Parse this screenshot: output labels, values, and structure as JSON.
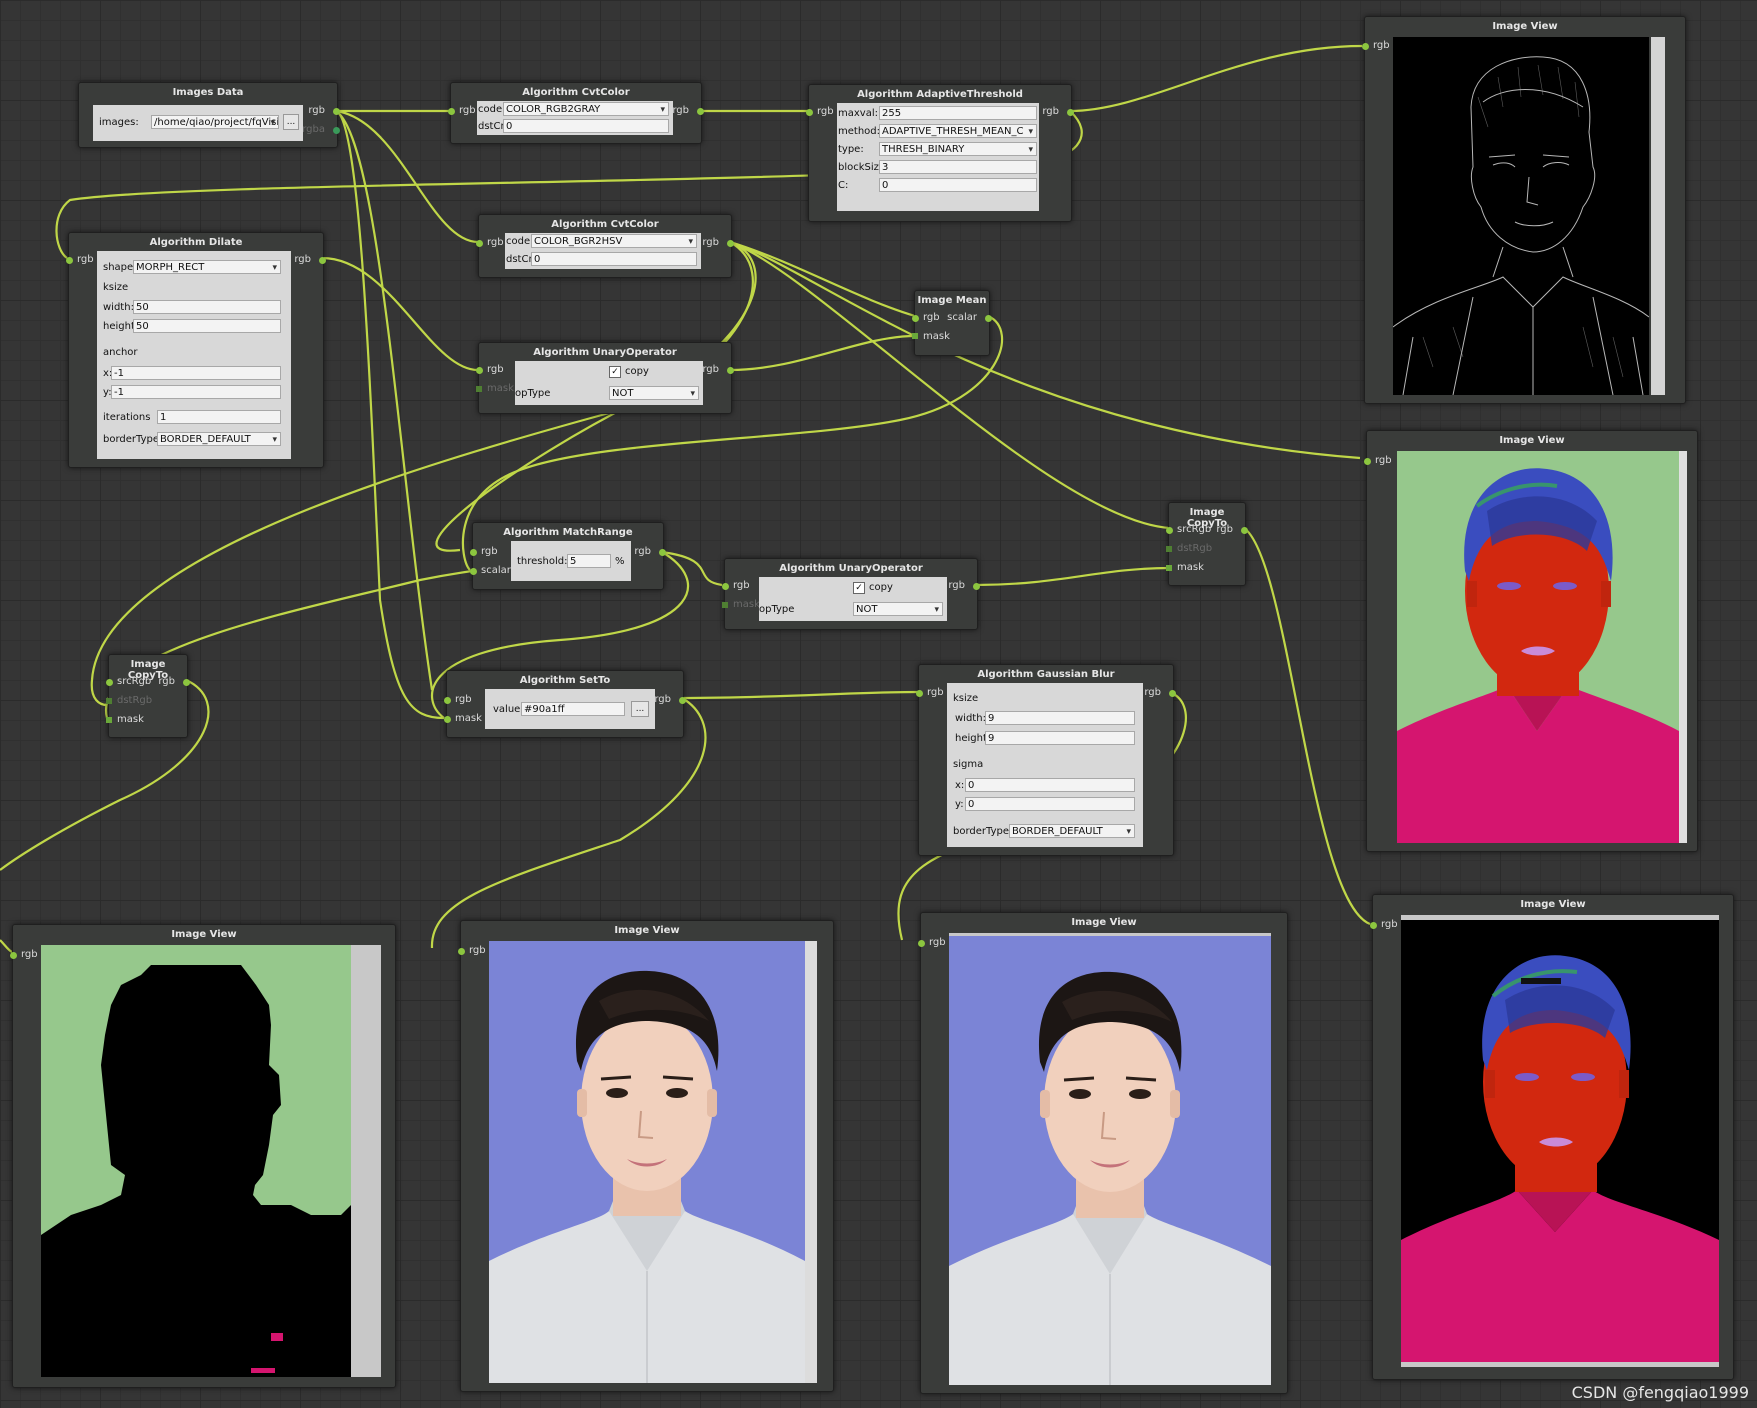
{
  "colors": {
    "wire": "#c8e04a",
    "background": "#353535",
    "node": "#3a3c3a",
    "accent": "#8cc63f",
    "mask_green": "#96c88c",
    "purple_bg": "#7b84d6",
    "hsv_red": "#d2280f",
    "hsv_magenta": "#d5156f"
  },
  "images_data": {
    "title": "Images Data",
    "images_label": "images:",
    "path": "/home/qiao/project/fqVisio",
    "browse": "...",
    "out_rgb": "rgb",
    "out_rgba": "rgba"
  },
  "cvt1": {
    "title": "Algorithm CvtColor",
    "in": "rgb",
    "out": "rgb",
    "code_label": "code:",
    "code": "COLOR_RGB2GRAY",
    "dstcn_label": "dstCn:",
    "dstcn": "0"
  },
  "adaptive": {
    "title": "Algorithm AdaptiveThreshold",
    "in": "rgb",
    "out": "rgb",
    "maxval_label": "maxval:",
    "maxval": "255",
    "method_label": "method:",
    "method": "ADAPTIVE_THRESH_MEAN_C",
    "type_label": "type:",
    "type": "THRESH_BINARY",
    "blocksize_label": "blockSize:",
    "blocksize": "3",
    "c_label": "C:",
    "c": "0"
  },
  "view_edges": {
    "title": "Image View",
    "in": "rgb"
  },
  "dilate": {
    "title": "Algorithm Dilate",
    "in": "rgb",
    "out": "rgb",
    "shape_label": "shape:",
    "shape": "MORPH_RECT",
    "ksize_label": "ksize",
    "width_label": "width:",
    "width": "50",
    "height_label": "height:",
    "height": "50",
    "anchor_label": "anchor",
    "x_label": "x:",
    "x": "-1",
    "y_label": "y:",
    "y": "-1",
    "iterations_label": "iterations",
    "iterations": "1",
    "border_label": "borderType:",
    "border": "BORDER_DEFAULT"
  },
  "cvt2": {
    "title": "Algorithm CvtColor",
    "in": "rgb",
    "out": "rgb",
    "code_label": "code:",
    "code": "COLOR_BGR2HSV",
    "dstcn_label": "dstCn:",
    "dstcn": "0"
  },
  "mean": {
    "title": "Image Mean",
    "in_rgb": "rgb",
    "in_mask": "mask",
    "out": "scalar"
  },
  "unary1": {
    "title": "Algorithm UnaryOperator",
    "in": "rgb",
    "in_mask": "mask",
    "out": "rgb",
    "copy": "copy",
    "optype_label": "opType",
    "optype": "NOT"
  },
  "view_hsv": {
    "title": "Image View",
    "in": "rgb"
  },
  "copyto_right": {
    "title": "Image CopyTo",
    "in_src": "srcRgb",
    "in_dst": "dstRgb",
    "in_mask": "mask",
    "out": "rgb"
  },
  "matchrange": {
    "title": "Algorithm MatchRange",
    "in_rgb": "rgb",
    "in_scalar": "scalar",
    "out": "rgb",
    "threshold_label": "threshold:",
    "threshold": "5",
    "unit": "%"
  },
  "unary2": {
    "title": "Algorithm UnaryOperator",
    "in": "rgb",
    "in_mask": "mask",
    "out": "rgb",
    "copy": "copy",
    "optype_label": "opType",
    "optype": "NOT"
  },
  "copyto_left": {
    "title": "Image CopyTo",
    "in_src": "srcRgb",
    "in_dst": "dstRgb",
    "in_mask": "mask",
    "out": "rgb"
  },
  "setto": {
    "title": "Algorithm SetTo",
    "in_rgb": "rgb",
    "in_mask": "mask",
    "out": "rgb",
    "value_label": "value:",
    "value": "#90a1ff",
    "browse": "..."
  },
  "gauss": {
    "title": "Algorithm Gaussian Blur",
    "in": "rgb",
    "out": "rgb",
    "ksize_label": "ksize",
    "width_label": "width:",
    "width": "9",
    "height_label": "height:",
    "height": "9",
    "sigma_label": "sigma",
    "x_label": "x:",
    "x": "0",
    "y_label": "y:",
    "y": "0",
    "border_label": "borderType:",
    "border": "BORDER_DEFAULT"
  },
  "view_mask": {
    "title": "Image View",
    "in": "rgb"
  },
  "view_setto": {
    "title": "Image View",
    "in": "rgb"
  },
  "view_blur": {
    "title": "Image View",
    "in": "rgb"
  },
  "view_copy": {
    "title": "Image View",
    "in": "rgb"
  },
  "watermark": "CSDN @fengqiao1999"
}
